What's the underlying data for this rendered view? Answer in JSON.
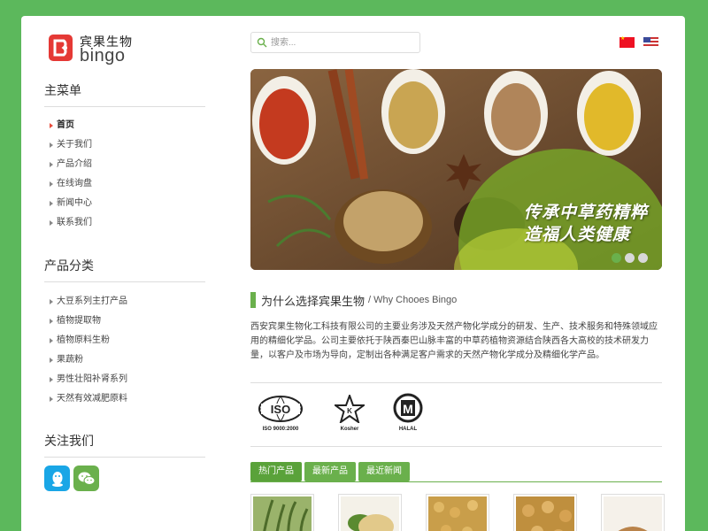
{
  "brand": {
    "name_cn": "宾果生物",
    "name_en": "bingo"
  },
  "sidebar": {
    "main_menu_title": "主菜单",
    "main_menu": [
      {
        "label": "首页",
        "active": true
      },
      {
        "label": "关于我们"
      },
      {
        "label": "产品介绍"
      },
      {
        "label": "在线询盘"
      },
      {
        "label": "新闻中心"
      },
      {
        "label": "联系我们"
      }
    ],
    "category_title": "产品分类",
    "categories": [
      {
        "label": "大豆系列主打产品"
      },
      {
        "label": "植物提取物"
      },
      {
        "label": "植物原料生粉"
      },
      {
        "label": "果蔬粉"
      },
      {
        "label": "男性壮阳补肾系列"
      },
      {
        "label": "天然有效减肥原料"
      }
    ],
    "follow_title": "关注我们",
    "social": [
      {
        "icon": "qq-icon"
      },
      {
        "icon": "wechat-icon"
      }
    ]
  },
  "search": {
    "placeholder": "搜索..."
  },
  "languages": [
    {
      "icon": "china-flag-icon"
    },
    {
      "icon": "us-flag-icon"
    }
  ],
  "banner": {
    "slogan_line1": "传承中草药精粹",
    "slogan_line2": "造福人类健康",
    "slides": 3,
    "active_slide": 1
  },
  "about": {
    "title": "为什么选择宾果生物",
    "subtitle": "/ Why Chooes Bingo",
    "body": "西安宾果生物化工科技有限公司的主要业务涉及天然产物化学成分的研发、生产、技术服务和特殊领域应用的精细化学品。公司主要依托于陕西秦巴山脉丰富的中草药植物资源结合陕西各大高校的技术研发力量，以客户及市场为导向，定制出各种满足客户需求的天然产物化学成分及精细化学产品。"
  },
  "certifications": [
    {
      "icon": "iso-icon",
      "label": "ISO 9000:2000"
    },
    {
      "icon": "kosher-icon",
      "label": "Kosher"
    },
    {
      "icon": "halal-icon",
      "label": "HALAL"
    }
  ],
  "product_tabs": [
    {
      "label": "热门产品",
      "active": true
    },
    {
      "label": "最新产品"
    },
    {
      "label": "最近新闻"
    }
  ],
  "products": [
    {
      "image": "herb-plant-thumbnail"
    },
    {
      "image": "soybean-bowl-thumbnail"
    },
    {
      "image": "soybeans-thumbnail"
    },
    {
      "image": "soybeans-closeup-thumbnail"
    },
    {
      "image": "grain-pile-thumbnail"
    }
  ],
  "colors": {
    "brand_green": "#6ab04c",
    "background_green": "#5cb85c",
    "logo_red": "#e53935"
  }
}
